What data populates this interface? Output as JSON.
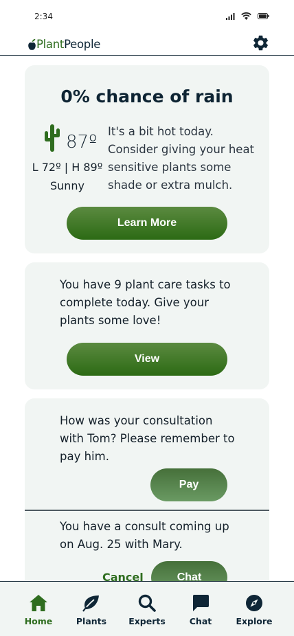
{
  "status_bar": {
    "time": "2:34"
  },
  "header": {
    "logo_plant": "Plant",
    "logo_people": "People"
  },
  "weather": {
    "title": "0% chance of rain",
    "temperature": "87º",
    "high_low": "L 72º | H 89º",
    "condition": "Sunny",
    "message": "It's a bit hot today. Consider giving your heat sensitive plants some shade or extra mulch.",
    "button_label": "Learn More"
  },
  "tasks": {
    "message": "You have 9 plant care tasks to complete today. Give your plants some love!",
    "button_label": "View"
  },
  "consult": {
    "payment_message": "How was your consultation with Tom? Please remember to pay him.",
    "pay_label": "Pay",
    "upcoming_message": "You have a consult coming up on Aug. 25 with Mary.",
    "cancel_label": "Cancel",
    "chat_label": "Chat"
  },
  "tab_bar": {
    "active": "Home",
    "items": [
      {
        "label": "Home",
        "icon": "home-icon"
      },
      {
        "label": "Plants",
        "icon": "leaf-icon"
      },
      {
        "label": "Experts",
        "icon": "search-icon"
      },
      {
        "label": "Chat",
        "icon": "chat-bubble-icon"
      },
      {
        "label": "Explore",
        "icon": "compass-icon"
      }
    ]
  },
  "colors": {
    "brand_green": "#2f6d1f",
    "navy": "#0f2636",
    "card_bg": "#f1f5f3"
  }
}
